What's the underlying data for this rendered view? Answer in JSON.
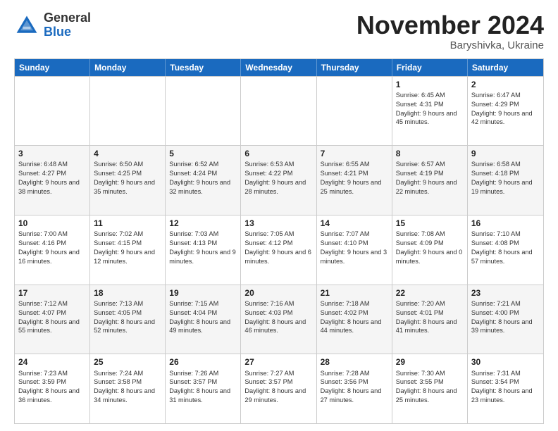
{
  "logo": {
    "general": "General",
    "blue": "Blue"
  },
  "header": {
    "month": "November 2024",
    "location": "Baryshivka, Ukraine"
  },
  "weekdays": [
    "Sunday",
    "Monday",
    "Tuesday",
    "Wednesday",
    "Thursday",
    "Friday",
    "Saturday"
  ],
  "weeks": [
    [
      {
        "day": "",
        "info": ""
      },
      {
        "day": "",
        "info": ""
      },
      {
        "day": "",
        "info": ""
      },
      {
        "day": "",
        "info": ""
      },
      {
        "day": "",
        "info": ""
      },
      {
        "day": "1",
        "info": "Sunrise: 6:45 AM\nSunset: 4:31 PM\nDaylight: 9 hours and 45 minutes."
      },
      {
        "day": "2",
        "info": "Sunrise: 6:47 AM\nSunset: 4:29 PM\nDaylight: 9 hours and 42 minutes."
      }
    ],
    [
      {
        "day": "3",
        "info": "Sunrise: 6:48 AM\nSunset: 4:27 PM\nDaylight: 9 hours and 38 minutes."
      },
      {
        "day": "4",
        "info": "Sunrise: 6:50 AM\nSunset: 4:25 PM\nDaylight: 9 hours and 35 minutes."
      },
      {
        "day": "5",
        "info": "Sunrise: 6:52 AM\nSunset: 4:24 PM\nDaylight: 9 hours and 32 minutes."
      },
      {
        "day": "6",
        "info": "Sunrise: 6:53 AM\nSunset: 4:22 PM\nDaylight: 9 hours and 28 minutes."
      },
      {
        "day": "7",
        "info": "Sunrise: 6:55 AM\nSunset: 4:21 PM\nDaylight: 9 hours and 25 minutes."
      },
      {
        "day": "8",
        "info": "Sunrise: 6:57 AM\nSunset: 4:19 PM\nDaylight: 9 hours and 22 minutes."
      },
      {
        "day": "9",
        "info": "Sunrise: 6:58 AM\nSunset: 4:18 PM\nDaylight: 9 hours and 19 minutes."
      }
    ],
    [
      {
        "day": "10",
        "info": "Sunrise: 7:00 AM\nSunset: 4:16 PM\nDaylight: 9 hours and 16 minutes."
      },
      {
        "day": "11",
        "info": "Sunrise: 7:02 AM\nSunset: 4:15 PM\nDaylight: 9 hours and 12 minutes."
      },
      {
        "day": "12",
        "info": "Sunrise: 7:03 AM\nSunset: 4:13 PM\nDaylight: 9 hours and 9 minutes."
      },
      {
        "day": "13",
        "info": "Sunrise: 7:05 AM\nSunset: 4:12 PM\nDaylight: 9 hours and 6 minutes."
      },
      {
        "day": "14",
        "info": "Sunrise: 7:07 AM\nSunset: 4:10 PM\nDaylight: 9 hours and 3 minutes."
      },
      {
        "day": "15",
        "info": "Sunrise: 7:08 AM\nSunset: 4:09 PM\nDaylight: 9 hours and 0 minutes."
      },
      {
        "day": "16",
        "info": "Sunrise: 7:10 AM\nSunset: 4:08 PM\nDaylight: 8 hours and 57 minutes."
      }
    ],
    [
      {
        "day": "17",
        "info": "Sunrise: 7:12 AM\nSunset: 4:07 PM\nDaylight: 8 hours and 55 minutes."
      },
      {
        "day": "18",
        "info": "Sunrise: 7:13 AM\nSunset: 4:05 PM\nDaylight: 8 hours and 52 minutes."
      },
      {
        "day": "19",
        "info": "Sunrise: 7:15 AM\nSunset: 4:04 PM\nDaylight: 8 hours and 49 minutes."
      },
      {
        "day": "20",
        "info": "Sunrise: 7:16 AM\nSunset: 4:03 PM\nDaylight: 8 hours and 46 minutes."
      },
      {
        "day": "21",
        "info": "Sunrise: 7:18 AM\nSunset: 4:02 PM\nDaylight: 8 hours and 44 minutes."
      },
      {
        "day": "22",
        "info": "Sunrise: 7:20 AM\nSunset: 4:01 PM\nDaylight: 8 hours and 41 minutes."
      },
      {
        "day": "23",
        "info": "Sunrise: 7:21 AM\nSunset: 4:00 PM\nDaylight: 8 hours and 39 minutes."
      }
    ],
    [
      {
        "day": "24",
        "info": "Sunrise: 7:23 AM\nSunset: 3:59 PM\nDaylight: 8 hours and 36 minutes."
      },
      {
        "day": "25",
        "info": "Sunrise: 7:24 AM\nSunset: 3:58 PM\nDaylight: 8 hours and 34 minutes."
      },
      {
        "day": "26",
        "info": "Sunrise: 7:26 AM\nSunset: 3:57 PM\nDaylight: 8 hours and 31 minutes."
      },
      {
        "day": "27",
        "info": "Sunrise: 7:27 AM\nSunset: 3:57 PM\nDaylight: 8 hours and 29 minutes."
      },
      {
        "day": "28",
        "info": "Sunrise: 7:28 AM\nSunset: 3:56 PM\nDaylight: 8 hours and 27 minutes."
      },
      {
        "day": "29",
        "info": "Sunrise: 7:30 AM\nSunset: 3:55 PM\nDaylight: 8 hours and 25 minutes."
      },
      {
        "day": "30",
        "info": "Sunrise: 7:31 AM\nSunset: 3:54 PM\nDaylight: 8 hours and 23 minutes."
      }
    ]
  ],
  "alt_rows": [
    1,
    3
  ]
}
